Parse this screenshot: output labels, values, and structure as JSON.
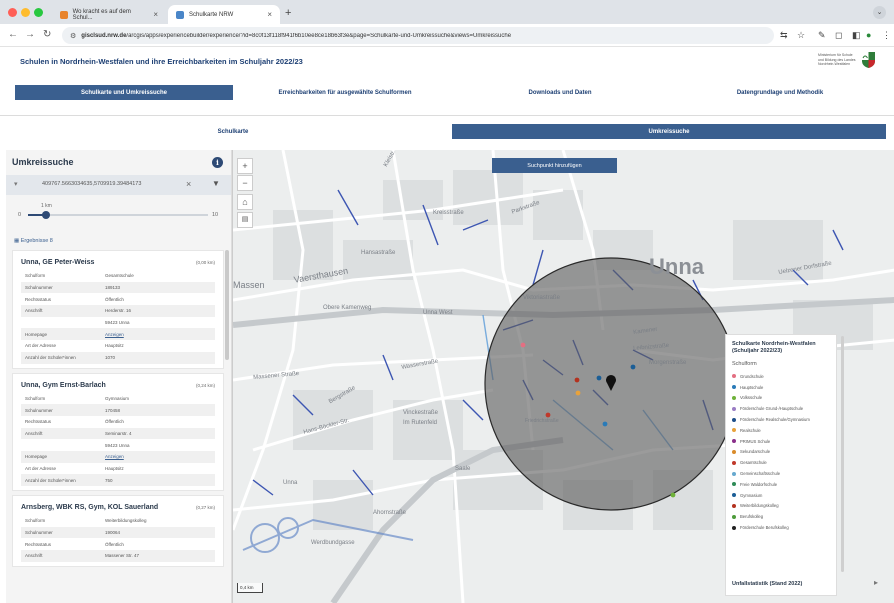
{
  "browser": {
    "tabs": [
      {
        "title": "Wo kracht es auf dem Schul...",
        "favicon_color": "#e8832b"
      },
      {
        "title": "Schulkarte NRW",
        "favicon_color": "#4a86c8"
      }
    ],
    "url_host": "gisclsud.nrw.de",
    "url_path": "/arcgis/apps/experiencebuilder/experience/?id=8c0f13f118f941f6b10ee8ce18b63f3e&page=Schulkarte-und-Umkreissuche&views=Umkreissuche"
  },
  "header": {
    "title": "Schulen in Nordrhein-Westfalen und ihre Erreichbarkeiten im Schuljahr 2022/23",
    "logo_text": "Ministerium für Schule und Bildung des Landes Nordrhein-Westfalen"
  },
  "nav": {
    "items": [
      {
        "label": "Schulkarte und Umkreissuche",
        "active": true
      },
      {
        "label": "Erreichbarkeiten für ausgewählte Schulformen",
        "active": false
      },
      {
        "label": "Downloads und Daten",
        "active": false
      },
      {
        "label": "Datengrundlage und Methodik",
        "active": false
      }
    ]
  },
  "subtabs": [
    {
      "label": "Schulkarte",
      "active": false
    },
    {
      "label": "Umkreissuche",
      "active": true
    }
  ],
  "panel": {
    "title": "Umkreissuche",
    "search_value": "409767.5663034635,5709919.39484173",
    "slider_label": "1 km",
    "slider_min": "0",
    "slider_max": "10",
    "slider_fraction": 0.1,
    "results_label": "Ergebnisse 8",
    "results": [
      {
        "name": "Unna, GE Peter-Weiss",
        "distance": "(0,00 km)",
        "attributes": [
          {
            "key": "Schulform",
            "value": "Gesamtschule"
          },
          {
            "key": "Schulnummer",
            "value": "189133"
          },
          {
            "key": "Rechtsstatus",
            "value": "Öffentlich"
          },
          {
            "key": "Anschrift",
            "value": "Herderstr. 16"
          },
          {
            "key": "",
            "value": "59423 Unna"
          },
          {
            "key": "Homepage",
            "value": "Anzeigen"
          },
          {
            "key": "Art der Adresse",
            "value": "Hauptsitz"
          },
          {
            "key": "Anzahl der Schüler*innen",
            "value": "1070"
          }
        ]
      },
      {
        "name": "Unna, Gym Ernst-Barlach",
        "distance": "(0,24 km)",
        "attributes": [
          {
            "key": "Schulform",
            "value": "Gymnasium"
          },
          {
            "key": "Schulnummer",
            "value": "170458"
          },
          {
            "key": "Rechtsstatus",
            "value": "Öffentlich"
          },
          {
            "key": "Anschrift",
            "value": "Seminarstr. 4"
          },
          {
            "key": "",
            "value": "59423 Unna"
          },
          {
            "key": "Homepage",
            "value": "Anzeigen"
          },
          {
            "key": "Art der Adresse",
            "value": "Hauptsitz"
          },
          {
            "key": "Anzahl der Schüler*innen",
            "value": "750"
          }
        ]
      },
      {
        "name": "Arnsberg, WBK RS, Gym, KOL Sauerland",
        "distance": "(0,27 km)",
        "attributes": [
          {
            "key": "Schulform",
            "value": "Weiterbildungskolleg"
          },
          {
            "key": "Schulnummer",
            "value": "190064"
          },
          {
            "key": "Rechtsstatus",
            "value": "Öffentlich"
          },
          {
            "key": "Anschrift",
            "value": "Massener Str. 47"
          }
        ]
      }
    ]
  },
  "map": {
    "search_point_button": "Suchpunkt hinzufügen",
    "scale_label": "0,4 km",
    "city_label": "Unna",
    "street_labels": [
      "Kleistr.",
      "Kreisstraße",
      "Hansastraße",
      "Parkstraße",
      "Vaersthausen",
      "Massener Straße",
      "Unna West",
      "Obere Kamenweg",
      "Wasserstraße",
      "Viktoriastraße",
      "Kamener",
      "Leibnizstraße",
      "Morgenstraße",
      "Vinckestraße",
      "Hans-Böckler-Str.",
      "Im Rutenfeld",
      "Massen",
      "Bergstraße",
      "Saale",
      "Ahornstraße",
      "Friedrichstraße",
      "Unna",
      "Werdbundgasse",
      "Uelzener Dorfstraße",
      "Kolpingstraße"
    ],
    "legend": {
      "title": "Schulkarte Nordrhein-Westfalen (Schuljahr 2022/23)",
      "subtitle": "Schulform",
      "items": [
        {
          "label": "Grundschule",
          "color": "#e36f82"
        },
        {
          "label": "Hauptschule",
          "color": "#2a7bb8"
        },
        {
          "label": "Volksschule",
          "color": "#6fb23a"
        },
        {
          "label": "Förderschule Grund-/Hauptschule",
          "color": "#9a7cc4"
        },
        {
          "label": "Förderschule Realschule/Gymnasium",
          "color": "#1e4f8a"
        },
        {
          "label": "Realschule",
          "color": "#e8a23b"
        },
        {
          "label": "PRIMUS Schule",
          "color": "#8a2f8a"
        },
        {
          "label": "Sekundarschule",
          "color": "#d98b2b"
        },
        {
          "label": "Gesamtschule",
          "color": "#c0392b"
        },
        {
          "label": "Gemeinschaftsschule",
          "color": "#67a9cf"
        },
        {
          "label": "Freie Waldorfschule",
          "color": "#2e8b57"
        },
        {
          "label": "Gymnasium",
          "color": "#1b5e96"
        },
        {
          "label": "Weiterbildungskolleg",
          "color": "#b3321f"
        },
        {
          "label": "Berufskolleg",
          "color": "#4d9b3a"
        },
        {
          "label": "Förderschule Berufskolleg",
          "color": "#222222"
        }
      ],
      "footer": "Unfallstatistik (Stand 2022)"
    }
  }
}
